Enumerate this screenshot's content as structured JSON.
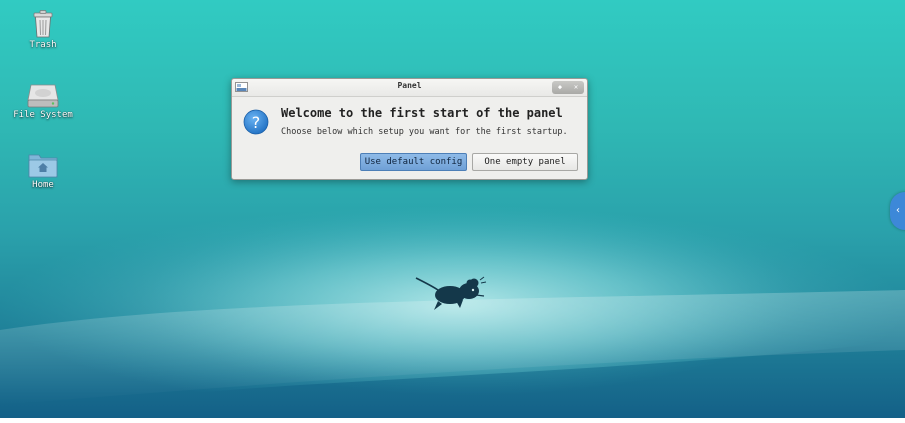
{
  "desktop": {
    "icons": [
      {
        "label": "Trash",
        "icon": "trash-icon"
      },
      {
        "label": "File System",
        "icon": "hard-drive-icon"
      },
      {
        "label": "Home",
        "icon": "home-folder-icon"
      }
    ],
    "wallpaper": {
      "icon": "xfce-mouse-logo"
    }
  },
  "dialog": {
    "title": "Panel",
    "heading": "Welcome to the first start of the panel",
    "message": "Choose below which setup you want for the first startup.",
    "buttons": {
      "default_label": "Use default config",
      "empty_label": "One empty panel"
    },
    "wm_buttons": {
      "restore": "◆",
      "close": "✕"
    },
    "icon": "question-icon"
  },
  "side_handle": {
    "glyph": "‹",
    "icon": "expand-handle-icon"
  },
  "colors": {
    "accent": "#6fa0d6",
    "desktop_top": "#31cbc2",
    "desktop_bottom": "#135e86"
  }
}
